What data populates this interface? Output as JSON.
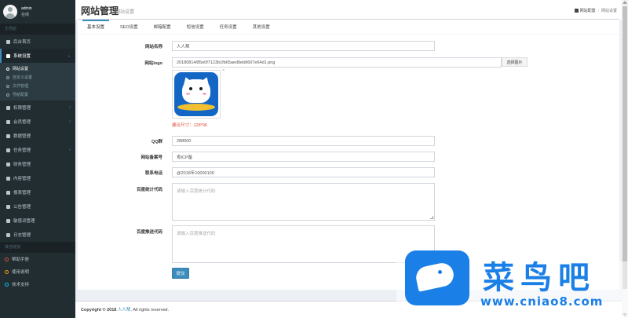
{
  "user": {
    "name": "admin",
    "status": "在线"
  },
  "nav": {
    "header_main": "主导航",
    "items": {
      "dashboard": "后台首页",
      "system": "系统设置",
      "sub_site": "网站设置",
      "sub_custom": "自定义设置",
      "sub_file": "文件管理",
      "sub_nav": "导航配置",
      "auth": "权限管理",
      "member": "会员管理",
      "data": "数据管理",
      "task": "任务管理",
      "finance": "财务管理",
      "content": "内容管理",
      "report": "报表管理",
      "notice": "公告管理",
      "sensitive": "敏感词管理",
      "log": "日志管理"
    },
    "header_ext": "其他链接",
    "ext": {
      "help": "帮助手册",
      "guide": "使用说明",
      "support": "技术支持"
    }
  },
  "header": {
    "title": "网站管理",
    "subtitle": "网站设置",
    "bc_home": "网站配置",
    "bc_current": "网站设置"
  },
  "tabs": [
    "基本设置",
    "SEO设置",
    "邮箱配置",
    "短信设置",
    "任务设置",
    "其他设置"
  ],
  "form": {
    "site_name_label": "网站名称",
    "site_name_value": "人人帮",
    "logo_label": "网站logo",
    "logo_value": "20180814/85e0f7123b1fb65aed9eb8607e64d1.png",
    "logo_button": "选择图片",
    "logo_close": "×",
    "logo_hint": "建议尺寸：128*96",
    "qq_label": "QQ群",
    "qq_value": "288000",
    "icp_label": "网站备案号",
    "icp_value": "粤ICP备",
    "contact_label": "联系电话",
    "contact_value": "@2018年10000100",
    "stats_label": "百度统计代码",
    "stats_placeholder": "请输入百度统计代码",
    "push_label": "百度推送代码",
    "push_placeholder": "请输入百度推送代码",
    "submit": "提交"
  },
  "footer": {
    "prefix": "Copyright © 2018",
    "brand": "人人帮",
    "suffix": ". All rights reserved."
  },
  "watermark": {
    "title": "菜鸟吧",
    "url": "www.cniao8.com"
  }
}
